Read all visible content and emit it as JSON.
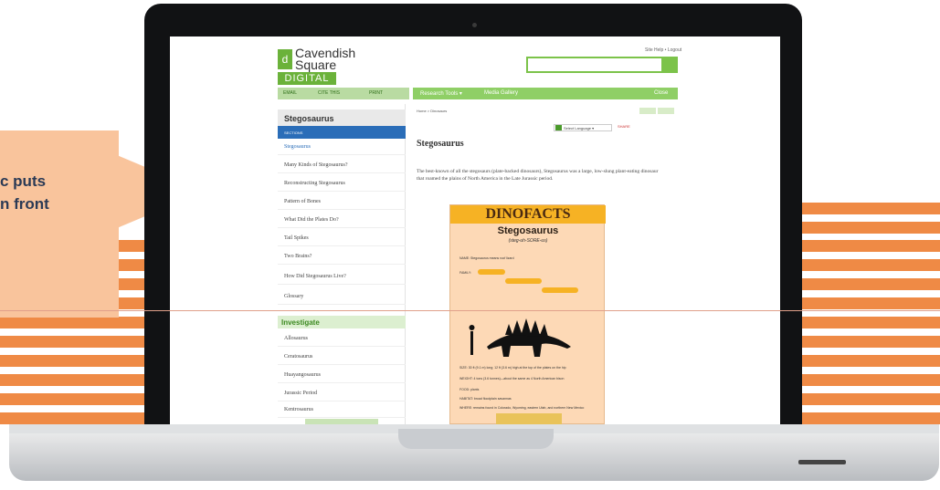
{
  "callout": {
    "line1": "c puts",
    "line2": "n front"
  },
  "site": {
    "logo": {
      "line1": "Cavendish",
      "line2": "Square",
      "digital": "DIGITAL",
      "mark": "d"
    },
    "top_links": "Site Help • Logout",
    "toolbar": {
      "email": "EMAIL",
      "cite": "CITE THIS",
      "print": "PRINT"
    },
    "nav": {
      "research": "Research Tools ▾",
      "media": "Media Gallery",
      "close": "Close"
    },
    "sidebar": {
      "title": "Stegosaurus",
      "sections_label": "SECTIONS",
      "items": [
        "Stegosaurus",
        "Many Kinds of Stegosaurus?",
        "Reconstructing Stegosaurus",
        "Pattern of Bones",
        "What Did the Plates Do?",
        "Tail Spikes",
        "Two Brains?",
        "How Did Stegosaurus Live?",
        "Glossary"
      ],
      "investigate_label": "Investigate",
      "investigate_items": [
        "Allosaurus",
        "Ceratosaurus",
        "Huayangosaurus",
        "Jurassic Period",
        "Kentrosaurus"
      ]
    },
    "content": {
      "breadcrumb": "Home > Dinosaurs",
      "language": "Select Language ▾",
      "share": "SHARE",
      "title": "Stegosaurus",
      "intro": "The best-known of all the stegosaurs (plate-backed dinosaurs), Stegosaurus was a large, low-slung plant-eating dinosaur that roamed the plains of North America in the Late Jurassic period.",
      "poster": {
        "header": "DINOFACTS",
        "name": "Stegosaurus",
        "pronunciation": "(steg-uh-SORE-us)",
        "name_line": "NAME: Stegosaurus means roof lizard",
        "family_label": "FAMILY:",
        "size": "SIZE: 30 ft (9.1 m) long; 12 ft (3.6 m) high at the top of the plates on the hip",
        "weight": "WEIGHT: 4 tons (3.6 tonnes)—about the same as 4 North American bison",
        "food": "FOOD: plants",
        "habitat": "HABITAT: broad floodplain savannas",
        "where": "WHERE: remains found in Colorado, Wyoming, eastern Utah, and northern New Mexico"
      }
    }
  },
  "colors": {
    "accent_green": "#7cc34a",
    "orange": "#ef8a45",
    "blue": "#2a6db8"
  }
}
